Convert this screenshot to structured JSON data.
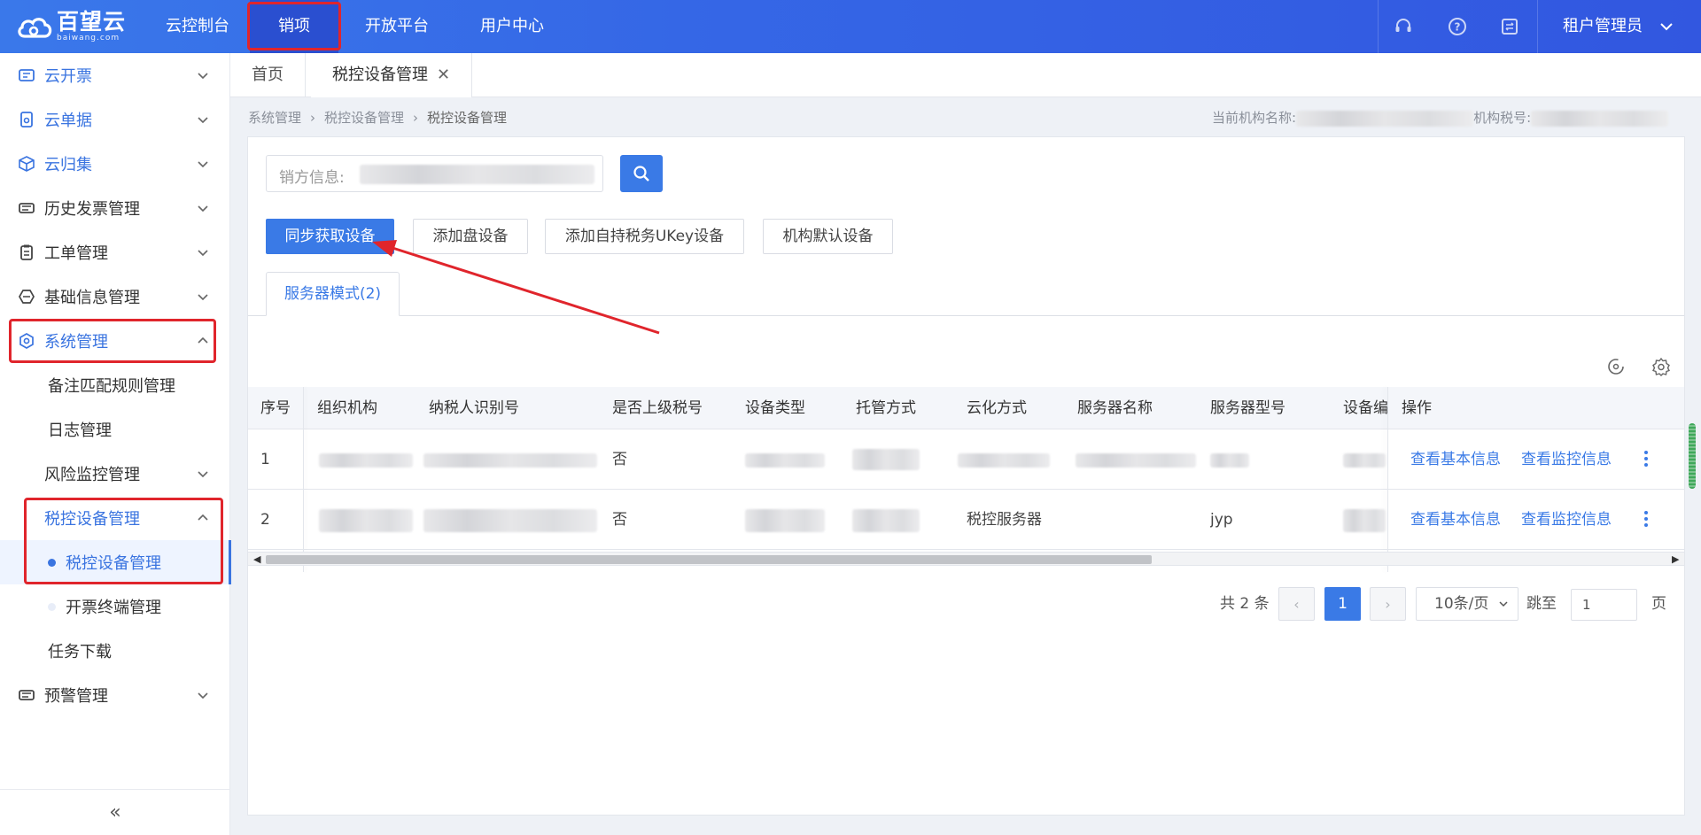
{
  "topbar": {
    "logo_main": "百望云",
    "logo_sub": "baiwang.com",
    "nav": [
      "云控制台",
      "销项",
      "开放平台",
      "用户中心"
    ],
    "active_nav": "销项",
    "user_name": "租户管理员"
  },
  "sidebar": {
    "items": [
      {
        "label": "云开票",
        "icon": "ticket-icon"
      },
      {
        "label": "云单据",
        "icon": "receipt-icon"
      },
      {
        "label": "云归集",
        "icon": "box-icon"
      },
      {
        "label": "历史发票管理",
        "icon": "invoice-history-icon"
      },
      {
        "label": "工单管理",
        "icon": "clipboard-icon"
      },
      {
        "label": "基础信息管理",
        "icon": "info-hub-icon"
      },
      {
        "label": "系统管理",
        "icon": "settings-hex-icon"
      },
      {
        "label": "备注匹配规则管理"
      },
      {
        "label": "日志管理"
      },
      {
        "label": "风险监控管理"
      },
      {
        "label": "税控设备管理"
      },
      {
        "label": "税控设备管理"
      },
      {
        "label": "开票终端管理"
      },
      {
        "label": "任务下载"
      },
      {
        "label": "预警管理",
        "icon": "ticket-icon"
      }
    ],
    "collapse_glyph": "«"
  },
  "tabs": {
    "home": "首页",
    "current": "税控设备管理",
    "close_glyph": "✕"
  },
  "breadcrumb": {
    "items": [
      "系统管理",
      "税控设备管理",
      "税控设备管理"
    ],
    "sep": "›",
    "org_label": "当前机构名称:",
    "tax_label": "机构税号:"
  },
  "search": {
    "label": "销方信息:"
  },
  "buttons": {
    "sync": "同步获取设备",
    "add_disk": "添加盘设备",
    "add_ukey": "添加自持税务UKey设备",
    "default_device": "机构默认设备"
  },
  "mode_tab": "服务器模式(2)",
  "table": {
    "headers": [
      "序号",
      "组织机构",
      "纳税人识别号",
      "是否上级税号",
      "设备类型",
      "托管方式",
      "云化方式",
      "服务器名称",
      "服务器型号",
      "设备编",
      "操作"
    ],
    "rows": [
      {
        "index": "1",
        "superior": "否",
        "cloud_mode": "",
        "server_model": "",
        "action1": "查看基本信息",
        "action2": "查看监控信息"
      },
      {
        "index": "2",
        "superior": "否",
        "cloud_mode": "税控服务器",
        "server_model": "jyp",
        "action1": "查看基本信息",
        "action2": "查看监控信息"
      }
    ]
  },
  "pagination": {
    "total": "共 2 条",
    "prev": "‹",
    "next": "›",
    "current": "1",
    "page_size": "10条/页",
    "jump_label": "跳至",
    "jump_value": "1",
    "page_suffix": "页"
  },
  "colors": {
    "brand": "#3a74e0",
    "highlight_box": "#e0252c"
  }
}
